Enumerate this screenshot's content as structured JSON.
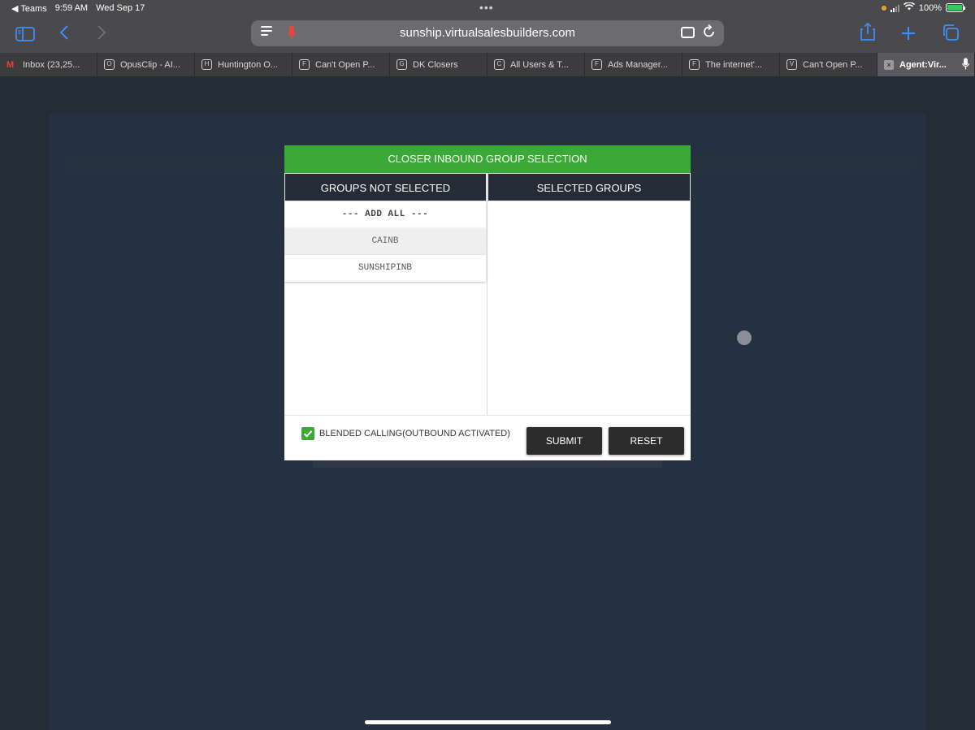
{
  "status_bar": {
    "back_app": "◀ Teams",
    "time": "9:59 AM",
    "date": "Wed Sep 17",
    "dots": "•••",
    "battery": "100%"
  },
  "toolbar": {
    "url": "sunship.virtualsalesbuilders.com"
  },
  "tabs": [
    {
      "favicon": "M",
      "label": "Inbox (23,25..."
    },
    {
      "favicon": "O",
      "label": "OpusClip - AI..."
    },
    {
      "favicon": "H",
      "label": "Huntington O..."
    },
    {
      "favicon": "F",
      "label": "Can't Open P..."
    },
    {
      "favicon": "G",
      "label": "DK Closers"
    },
    {
      "favicon": "C",
      "label": "All Users & T..."
    },
    {
      "favicon": "F",
      "label": "Ads Manager..."
    },
    {
      "favicon": "F",
      "label": "The internet'..."
    },
    {
      "favicon": "V",
      "label": "Can't Open P..."
    },
    {
      "favicon": "×",
      "label": "Agent:Vir..."
    }
  ],
  "modal": {
    "title": "CLOSER INBOUND GROUP SELECTION",
    "left_header": "GROUPS NOT SELECTED",
    "right_header": "SELECTED GROUPS",
    "add_all": "--- ADD ALL ---",
    "groups": [
      "CAINB",
      "SUNSHIPINB"
    ],
    "blended_label": "BLENDED CALLING(OUTBOUND ACTIVATED)",
    "blended_checked": true,
    "submit_label": "SUBMIT",
    "reset_label": "RESET"
  },
  "colors": {
    "header_green": "#3aa935",
    "dark_navy": "#232c37",
    "button_dark": "#2c2c2c",
    "safari_blue": "#3d8ef5"
  }
}
